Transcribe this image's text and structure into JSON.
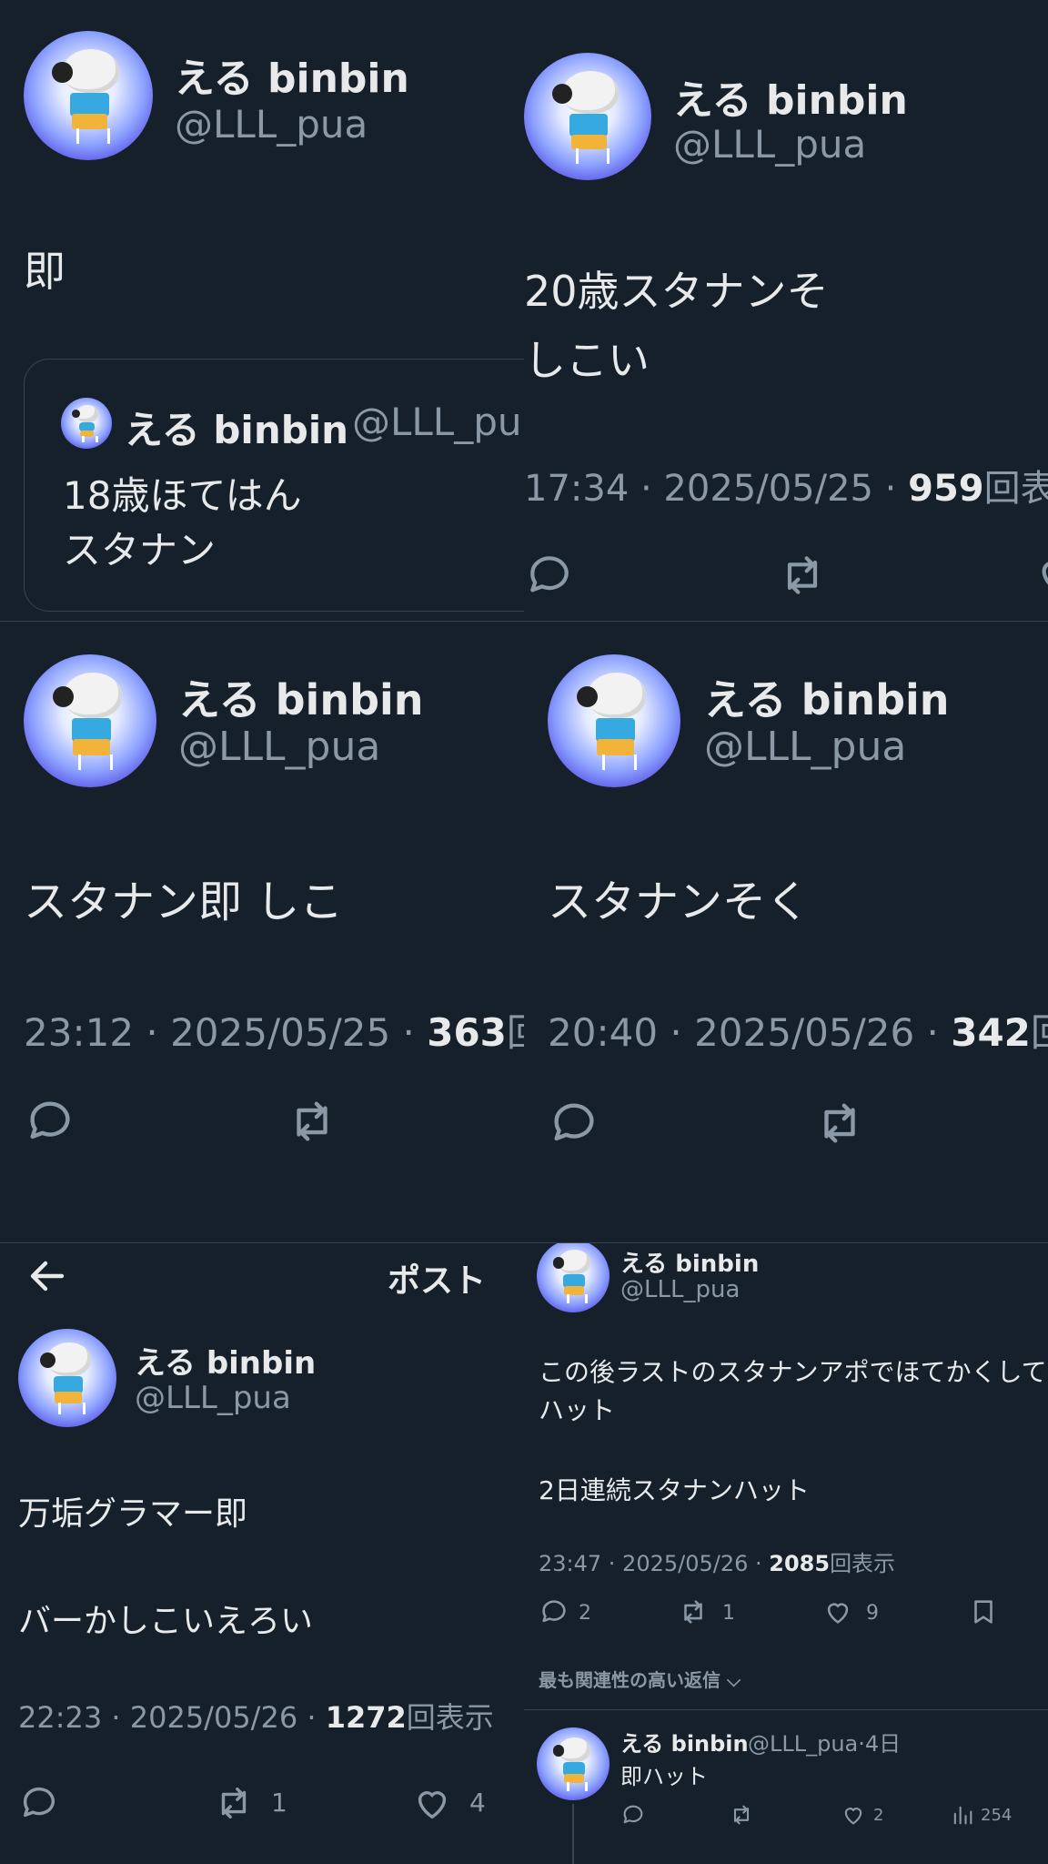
{
  "user": {
    "name": "える binbin",
    "handle": "@LLL_pua"
  },
  "panel1": {
    "text": "即",
    "quote": {
      "name": "える binbin",
      "handle": "@LLL_pu",
      "line1": "18歳ほてはん",
      "line2": "スタナン"
    }
  },
  "panel2": {
    "line1": "20歳スタナンそ",
    "line2": "しこい",
    "meta_prefix": "17:34 · 2025/05/25 · ",
    "views": "959",
    "views_suffix": "回表"
  },
  "panel3": {
    "text": "スタナン即 しこ",
    "meta_prefix": "23:12 · 2025/05/25 · ",
    "views": "363",
    "views_suffix": "回"
  },
  "panel4": {
    "text": "スタナンそく",
    "meta_prefix": "20:40 · 2025/05/26 · ",
    "views": "342",
    "views_suffix": "回"
  },
  "panel5": {
    "header_title": "ポスト",
    "line1": "万垢グラマー即",
    "line2": "バーかしこいえろい",
    "meta_prefix": "22:23 · 2025/05/26 · ",
    "views": "1272",
    "views_suffix": "回表示",
    "retweets": "1",
    "likes": "4"
  },
  "panel6": {
    "line1": "この後ラストのスタナンアポでほてかくして",
    "line2": "ハット",
    "line3": "2日連続スタナンハット",
    "meta_prefix": "23:47 · 2025/05/26 · ",
    "views": "2085",
    "views_suffix": "回表示",
    "replies": "2",
    "retweets": "1",
    "likes": "9",
    "sort_label": "最も関連性の高い返信",
    "reply": {
      "name": "える binbin",
      "handle_time": "@LLL_pua·4日",
      "text": "即ハット",
      "likes": "2",
      "views": "254"
    }
  }
}
